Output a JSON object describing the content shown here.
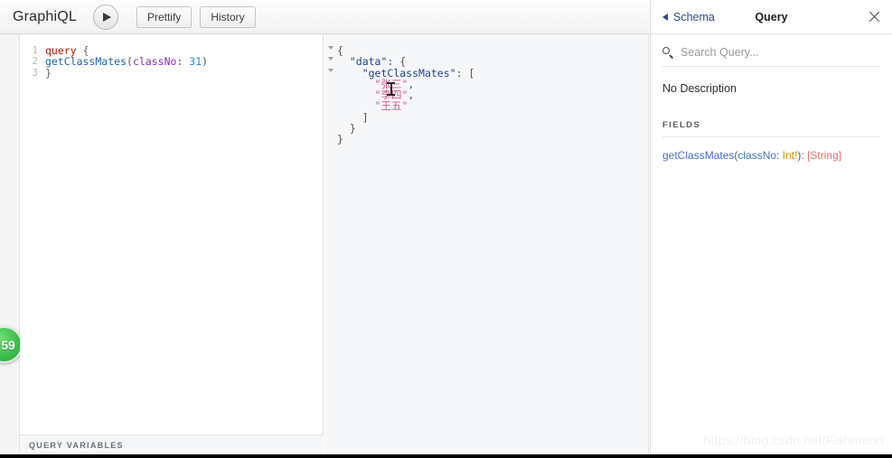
{
  "toolbar": {
    "brand": "GraphiQL",
    "execute_label": "▶",
    "prettify_label": "Prettify",
    "history_label": "History"
  },
  "notification_badge": {
    "count": "59"
  },
  "query_editor": {
    "lines": [
      {
        "number": "1",
        "tokens": [
          {
            "text": "query",
            "kind": "key"
          },
          {
            "text": " ",
            "kind": "punc"
          },
          {
            "text": "{",
            "kind": "brace"
          }
        ]
      },
      {
        "number": "2",
        "tokens": [
          {
            "text": "getClassMates",
            "kind": "field"
          },
          {
            "text": "(",
            "kind": "punc"
          },
          {
            "text": "classNo",
            "kind": "arg"
          },
          {
            "text": ": ",
            "kind": "punc"
          },
          {
            "text": "31",
            "kind": "num"
          },
          {
            "text": ")",
            "kind": "punc"
          }
        ]
      },
      {
        "number": "3",
        "tokens": [
          {
            "text": "}",
            "kind": "brace"
          }
        ]
      }
    ]
  },
  "query_variables": {
    "label": "QUERY VARIABLES"
  },
  "result_pane": {
    "lines": [
      {
        "fold": true,
        "tokens": [
          {
            "text": "{",
            "kind": "punc"
          }
        ]
      },
      {
        "fold": true,
        "tokens": [
          {
            "text": "  ",
            "kind": "punc"
          },
          {
            "text": "\"data\"",
            "kind": "key"
          },
          {
            "text": ": {",
            "kind": "punc"
          }
        ]
      },
      {
        "fold": true,
        "tokens": [
          {
            "text": "    ",
            "kind": "punc"
          },
          {
            "text": "\"getClassMates\"",
            "kind": "key"
          },
          {
            "text": ": [",
            "kind": "punc"
          }
        ]
      },
      {
        "fold": false,
        "tokens": [
          {
            "text": "      ",
            "kind": "punc"
          },
          {
            "text": "\"张三\"",
            "kind": "str"
          },
          {
            "text": ",",
            "kind": "punc"
          }
        ]
      },
      {
        "fold": false,
        "tokens": [
          {
            "text": "      ",
            "kind": "punc"
          },
          {
            "text": "\"李四\"",
            "kind": "str"
          },
          {
            "text": ",",
            "kind": "punc"
          }
        ]
      },
      {
        "fold": false,
        "tokens": [
          {
            "text": "      ",
            "kind": "punc"
          },
          {
            "text": "\"王五\"",
            "kind": "str"
          }
        ]
      },
      {
        "fold": false,
        "tokens": [
          {
            "text": "    ]",
            "kind": "punc"
          }
        ]
      },
      {
        "fold": false,
        "tokens": [
          {
            "text": "  }",
            "kind": "punc"
          }
        ]
      },
      {
        "fold": false,
        "tokens": [
          {
            "text": "}",
            "kind": "punc"
          }
        ]
      }
    ]
  },
  "docs_panel": {
    "back_label": "Schema",
    "title": "Query",
    "close_label": "×",
    "search_placeholder": "Search Query...",
    "description": "No Description",
    "fields_heading": "FIELDS",
    "field_signature": [
      {
        "text": "getClassMates",
        "kind": "name"
      },
      {
        "text": "(",
        "kind": "punc"
      },
      {
        "text": "classNo",
        "kind": "arg"
      },
      {
        "text": ": ",
        "kind": "punc"
      },
      {
        "text": "Int!",
        "kind": "int"
      },
      {
        "text": "): ",
        "kind": "punc"
      },
      {
        "text": "[String]",
        "kind": "str"
      }
    ]
  },
  "watermark": {
    "text": "https://blog.csdn.net/Fishmann"
  },
  "colors": {
    "accent_blue": "#2c4a87",
    "badge_green": "#3fbf50",
    "string_pink": "#d6568c",
    "int_gold": "#d4920c",
    "list_salmon": "#e2706a"
  }
}
